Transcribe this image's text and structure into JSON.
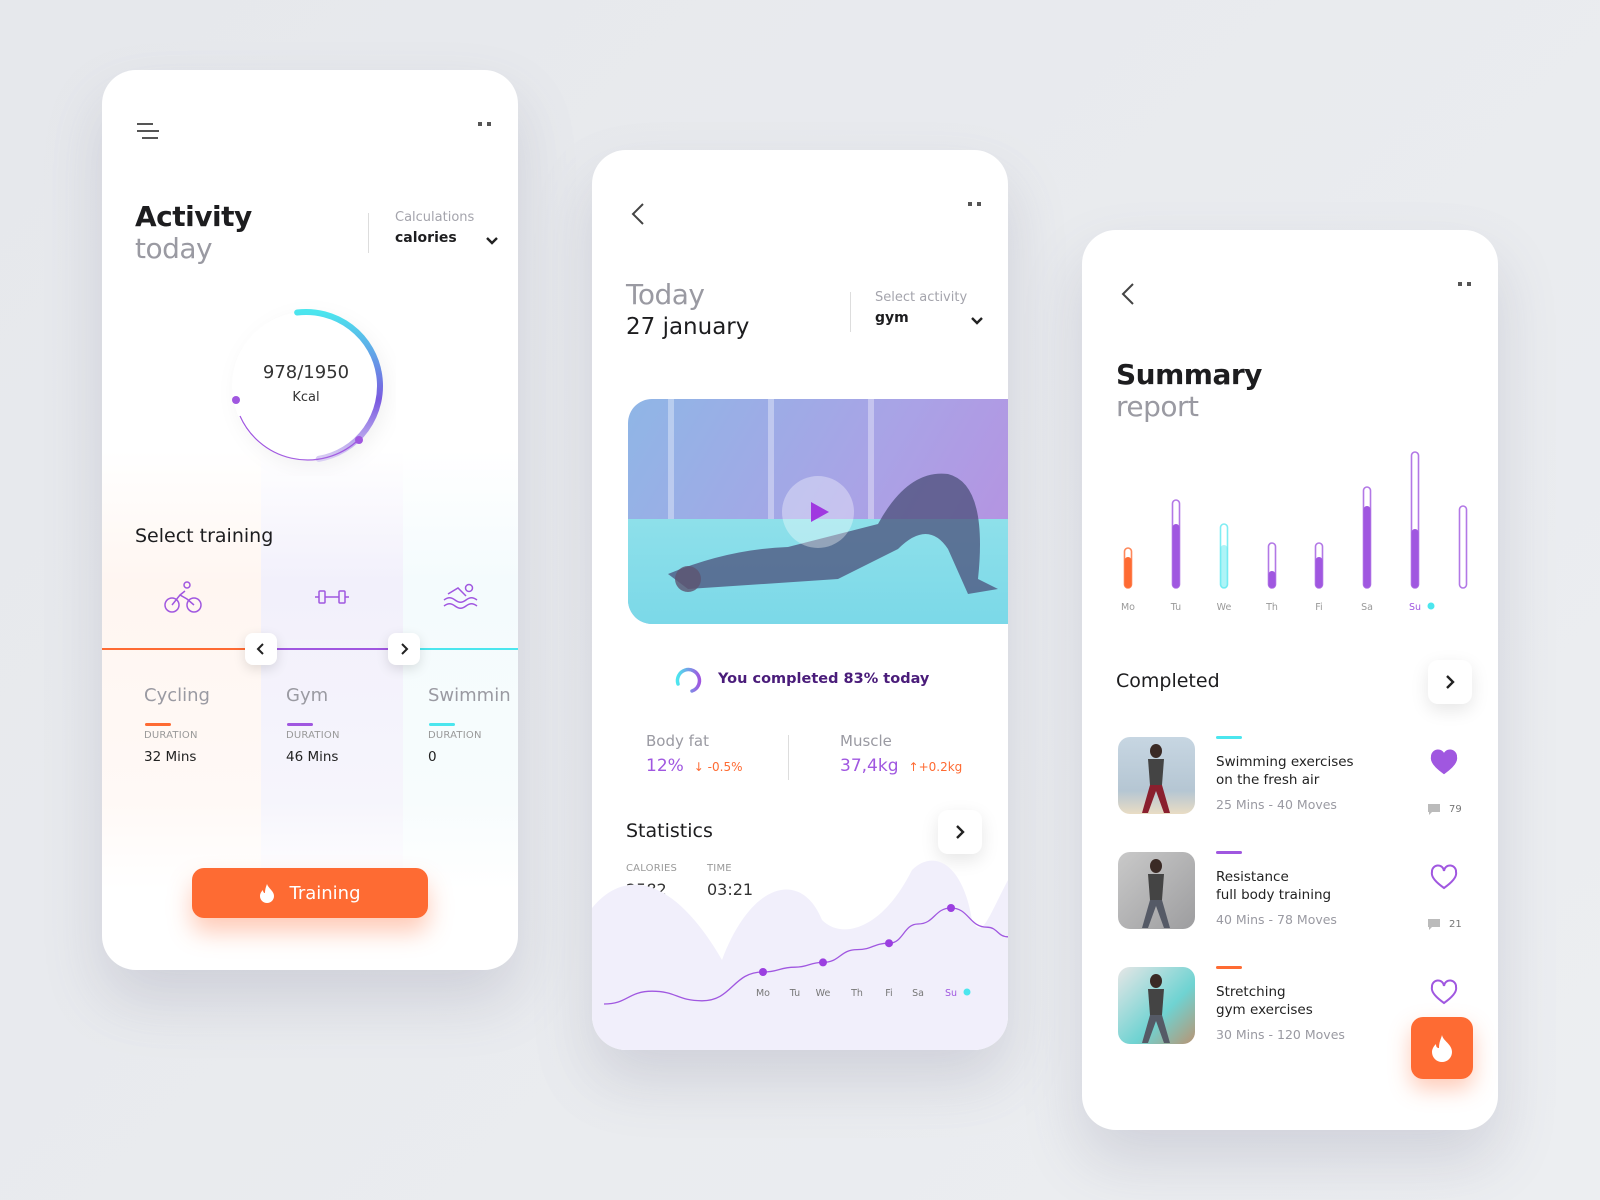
{
  "colors": {
    "orange": "#fe6b33",
    "purple": "#a057e0",
    "cyan": "#4be6ee",
    "dark_purple": "#4a1c7a"
  },
  "activity": {
    "icons": {
      "menu": "menu-icon",
      "more": "more-dots-icon"
    },
    "title_bold": "Activity",
    "title_light": "today",
    "calc_label": "Calculations",
    "calc_value": "calories",
    "ring": {
      "current": 978,
      "goal": 1950,
      "value_text": "978/1950",
      "unit": "Kcal"
    },
    "select_training": "Select training",
    "trainings": [
      {
        "name": "Cycling",
        "icon": "bicycle-icon",
        "duration_label": "DURATION",
        "duration": "32 Mins",
        "color": "#fe6b33"
      },
      {
        "name": "Gym",
        "icon": "dumbbell-icon",
        "duration_label": "DURATION",
        "duration": "46 Mins",
        "color": "#a057e0"
      },
      {
        "name": "Swimmin",
        "icon": "swimming-icon",
        "duration_label": "DURATION",
        "duration": "0",
        "color": "#4be6ee"
      }
    ],
    "training_button": "Training"
  },
  "today": {
    "title_light": "Today",
    "date": "27 january",
    "select_label": "Select activity",
    "select_value": "gym",
    "completed_text": "You completed 83% today",
    "completed_percent": 83,
    "body_fat": {
      "label": "Body fat",
      "value": "12%",
      "change": "-0.5%"
    },
    "muscle": {
      "label": "Muscle",
      "value": "37,4kg",
      "change": "+0.2kg"
    },
    "statistics": {
      "title": "Statistics",
      "calories_label": "CALORIES",
      "calories": "2582",
      "time_label": "TIME",
      "time": "03:21"
    }
  },
  "summary": {
    "title_bold": "Summary",
    "title_light": "report",
    "completed_title": "Completed",
    "items": [
      {
        "title1": "Swimming exercises",
        "title2": "on the fresh air",
        "meta": "25 Mins - 40 Moves",
        "comments": "79",
        "liked": true,
        "color": "#4be6ee"
      },
      {
        "title1": "Resistance",
        "title2": "full body training",
        "meta": "40 Mins - 78 Moves",
        "comments": "21",
        "liked": false,
        "color": "#a057e0"
      },
      {
        "title1": "Stretching",
        "title2": "gym exercises",
        "meta": "30 Mins - 120 Moves",
        "comments": "",
        "liked": false,
        "color": "#fe6b33"
      }
    ]
  },
  "chart_data": [
    {
      "type": "bar",
      "categories": [
        "Mo",
        "Tu",
        "We",
        "Th",
        "Fi",
        "Sa",
        "Su",
        ""
      ],
      "series": [
        {
          "values": [
            31,
            64,
            43,
            17,
            31,
            82,
            59,
            0
          ]
        }
      ],
      "goal": [
        40,
        88,
        64,
        45,
        45,
        101,
        136,
        82
      ],
      "bar_colors": [
        "#fe6b33",
        "#a057e0",
        "#4be6ee",
        "#a057e0",
        "#a057e0",
        "#a057e0",
        "#a057e0",
        "#a057e0"
      ],
      "highlight": "Su",
      "ylim": [
        0,
        140
      ],
      "grid": false
    },
    {
      "type": "line",
      "categories": [
        "Mo",
        "Tu",
        "We",
        "Th",
        "Fi",
        "Sa",
        "Su"
      ],
      "series": [
        {
          "values": [
            30,
            33,
            36,
            44,
            48,
            60,
            70
          ]
        }
      ],
      "markers": [
        "Mo",
        "We",
        "Fi",
        "Su"
      ],
      "highlight": "Su",
      "ylim": [
        0,
        100
      ],
      "grid": false
    }
  ]
}
